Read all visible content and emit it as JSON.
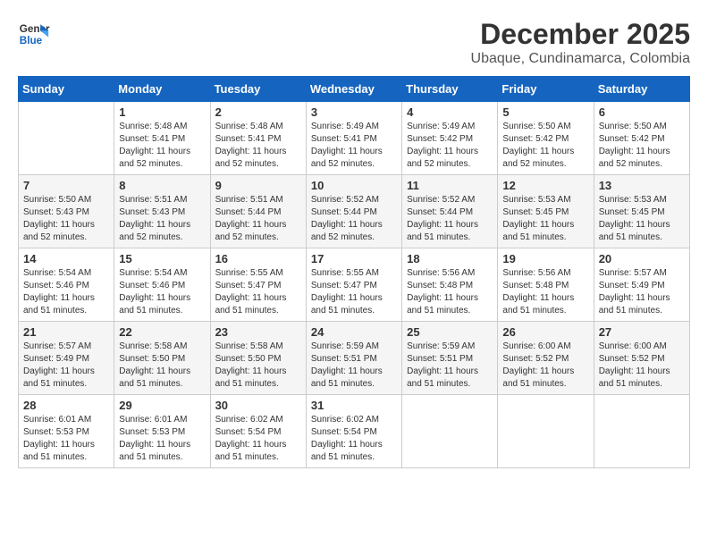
{
  "header": {
    "logo_line1": "General",
    "logo_line2": "Blue",
    "main_title": "December 2025",
    "subtitle": "Ubaque, Cundinamarca, Colombia"
  },
  "days_of_week": [
    "Sunday",
    "Monday",
    "Tuesday",
    "Wednesday",
    "Thursday",
    "Friday",
    "Saturday"
  ],
  "weeks": [
    [
      {
        "day": "",
        "info": ""
      },
      {
        "day": "1",
        "info": "Sunrise: 5:48 AM\nSunset: 5:41 PM\nDaylight: 11 hours\nand 52 minutes."
      },
      {
        "day": "2",
        "info": "Sunrise: 5:48 AM\nSunset: 5:41 PM\nDaylight: 11 hours\nand 52 minutes."
      },
      {
        "day": "3",
        "info": "Sunrise: 5:49 AM\nSunset: 5:41 PM\nDaylight: 11 hours\nand 52 minutes."
      },
      {
        "day": "4",
        "info": "Sunrise: 5:49 AM\nSunset: 5:42 PM\nDaylight: 11 hours\nand 52 minutes."
      },
      {
        "day": "5",
        "info": "Sunrise: 5:50 AM\nSunset: 5:42 PM\nDaylight: 11 hours\nand 52 minutes."
      },
      {
        "day": "6",
        "info": "Sunrise: 5:50 AM\nSunset: 5:42 PM\nDaylight: 11 hours\nand 52 minutes."
      }
    ],
    [
      {
        "day": "7",
        "info": "Sunrise: 5:50 AM\nSunset: 5:43 PM\nDaylight: 11 hours\nand 52 minutes."
      },
      {
        "day": "8",
        "info": "Sunrise: 5:51 AM\nSunset: 5:43 PM\nDaylight: 11 hours\nand 52 minutes."
      },
      {
        "day": "9",
        "info": "Sunrise: 5:51 AM\nSunset: 5:44 PM\nDaylight: 11 hours\nand 52 minutes."
      },
      {
        "day": "10",
        "info": "Sunrise: 5:52 AM\nSunset: 5:44 PM\nDaylight: 11 hours\nand 52 minutes."
      },
      {
        "day": "11",
        "info": "Sunrise: 5:52 AM\nSunset: 5:44 PM\nDaylight: 11 hours\nand 51 minutes."
      },
      {
        "day": "12",
        "info": "Sunrise: 5:53 AM\nSunset: 5:45 PM\nDaylight: 11 hours\nand 51 minutes."
      },
      {
        "day": "13",
        "info": "Sunrise: 5:53 AM\nSunset: 5:45 PM\nDaylight: 11 hours\nand 51 minutes."
      }
    ],
    [
      {
        "day": "14",
        "info": "Sunrise: 5:54 AM\nSunset: 5:46 PM\nDaylight: 11 hours\nand 51 minutes."
      },
      {
        "day": "15",
        "info": "Sunrise: 5:54 AM\nSunset: 5:46 PM\nDaylight: 11 hours\nand 51 minutes."
      },
      {
        "day": "16",
        "info": "Sunrise: 5:55 AM\nSunset: 5:47 PM\nDaylight: 11 hours\nand 51 minutes."
      },
      {
        "day": "17",
        "info": "Sunrise: 5:55 AM\nSunset: 5:47 PM\nDaylight: 11 hours\nand 51 minutes."
      },
      {
        "day": "18",
        "info": "Sunrise: 5:56 AM\nSunset: 5:48 PM\nDaylight: 11 hours\nand 51 minutes."
      },
      {
        "day": "19",
        "info": "Sunrise: 5:56 AM\nSunset: 5:48 PM\nDaylight: 11 hours\nand 51 minutes."
      },
      {
        "day": "20",
        "info": "Sunrise: 5:57 AM\nSunset: 5:49 PM\nDaylight: 11 hours\nand 51 minutes."
      }
    ],
    [
      {
        "day": "21",
        "info": "Sunrise: 5:57 AM\nSunset: 5:49 PM\nDaylight: 11 hours\nand 51 minutes."
      },
      {
        "day": "22",
        "info": "Sunrise: 5:58 AM\nSunset: 5:50 PM\nDaylight: 11 hours\nand 51 minutes."
      },
      {
        "day": "23",
        "info": "Sunrise: 5:58 AM\nSunset: 5:50 PM\nDaylight: 11 hours\nand 51 minutes."
      },
      {
        "day": "24",
        "info": "Sunrise: 5:59 AM\nSunset: 5:51 PM\nDaylight: 11 hours\nand 51 minutes."
      },
      {
        "day": "25",
        "info": "Sunrise: 5:59 AM\nSunset: 5:51 PM\nDaylight: 11 hours\nand 51 minutes."
      },
      {
        "day": "26",
        "info": "Sunrise: 6:00 AM\nSunset: 5:52 PM\nDaylight: 11 hours\nand 51 minutes."
      },
      {
        "day": "27",
        "info": "Sunrise: 6:00 AM\nSunset: 5:52 PM\nDaylight: 11 hours\nand 51 minutes."
      }
    ],
    [
      {
        "day": "28",
        "info": "Sunrise: 6:01 AM\nSunset: 5:53 PM\nDaylight: 11 hours\nand 51 minutes."
      },
      {
        "day": "29",
        "info": "Sunrise: 6:01 AM\nSunset: 5:53 PM\nDaylight: 11 hours\nand 51 minutes."
      },
      {
        "day": "30",
        "info": "Sunrise: 6:02 AM\nSunset: 5:54 PM\nDaylight: 11 hours\nand 51 minutes."
      },
      {
        "day": "31",
        "info": "Sunrise: 6:02 AM\nSunset: 5:54 PM\nDaylight: 11 hours\nand 51 minutes."
      },
      {
        "day": "",
        "info": ""
      },
      {
        "day": "",
        "info": ""
      },
      {
        "day": "",
        "info": ""
      }
    ]
  ]
}
